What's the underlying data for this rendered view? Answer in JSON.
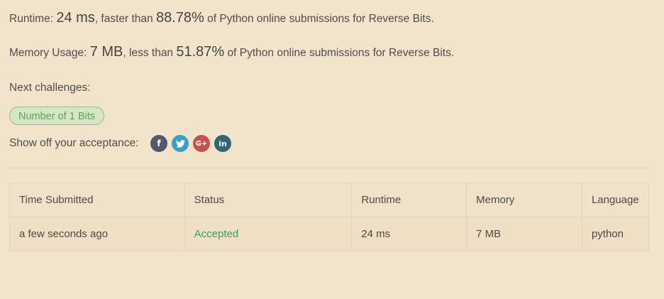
{
  "result": {
    "runtime_label": "Runtime:",
    "runtime_value": "24 ms",
    "runtime_mid": ", faster than ",
    "runtime_percent": "88.78%",
    "runtime_tail": " of Python online submissions for Reverse Bits.",
    "memory_label": "Memory Usage:",
    "memory_value": "7 MB",
    "memory_mid": ", less than ",
    "memory_percent": "51.87%",
    "memory_tail": " of Python online submissions for Reverse Bits."
  },
  "next": {
    "label": "Next challenges:",
    "challenges": [
      "Number of 1 Bits"
    ]
  },
  "share": {
    "label": "Show off your acceptance:",
    "icons": [
      {
        "name": "facebook-icon",
        "glyph": "f",
        "color": "#58556d"
      },
      {
        "name": "twitter-icon",
        "glyph": "t",
        "color": "#3a9fc2"
      },
      {
        "name": "google-plus-icon",
        "glyph": "G+",
        "color": "#c4534e"
      },
      {
        "name": "linkedin-icon",
        "glyph": "in",
        "color": "#2f6574"
      }
    ]
  },
  "table": {
    "headers": [
      "Time Submitted",
      "Status",
      "Runtime",
      "Memory",
      "Language"
    ],
    "rows": [
      [
        "a few seconds ago",
        "Accepted",
        "24 ms",
        "7 MB",
        "python"
      ]
    ]
  },
  "colors": {
    "background": "#f2e4cb",
    "accepted": "#3f9a63",
    "pill_text": "#5ba25b",
    "pill_bg": "#d6e5c4"
  }
}
